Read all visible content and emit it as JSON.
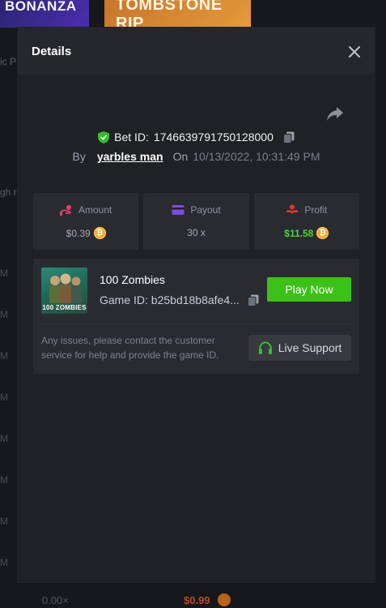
{
  "background": {
    "thumb1_text": "BONANZA",
    "thumb2_text": "TOMBSTONE RIP",
    "side_label_1": "ic P",
    "side_label_2": "gh r",
    "row_suffix": "M",
    "bottom_multiplier": "0.00×",
    "bottom_amount": "$0.99"
  },
  "modal": {
    "title": "Details",
    "bet_label": "Bet ID:",
    "bet_id": "1746639791750128000",
    "by_label": "By",
    "username": "yarbles man",
    "on_label": "On",
    "date": "10/13/2022, 10:31:49 PM"
  },
  "stats": [
    {
      "label": "Amount",
      "value": "$0.39",
      "icon": "amount-icon",
      "color": "#e0416e"
    },
    {
      "label": "Payout",
      "value": "30 x",
      "icon": "payout-icon",
      "color": "#7b4ce0"
    },
    {
      "label": "Profit",
      "value": "$11.58",
      "icon": "profit-icon",
      "color": "#e03b2f"
    }
  ],
  "game": {
    "name": "100 Zombies",
    "thumb_label": "100 ZOMBIES",
    "id_text": "Game ID: b25bd18b8afe4...",
    "play_label": "Play Now",
    "issue_text": "Any issues, please contact the customer service for help and provide the game ID.",
    "support_label": "Live Support"
  },
  "colors": {
    "accent_green": "#3bc117",
    "profit_green": "#4fd434",
    "coin": "#f5a623"
  }
}
